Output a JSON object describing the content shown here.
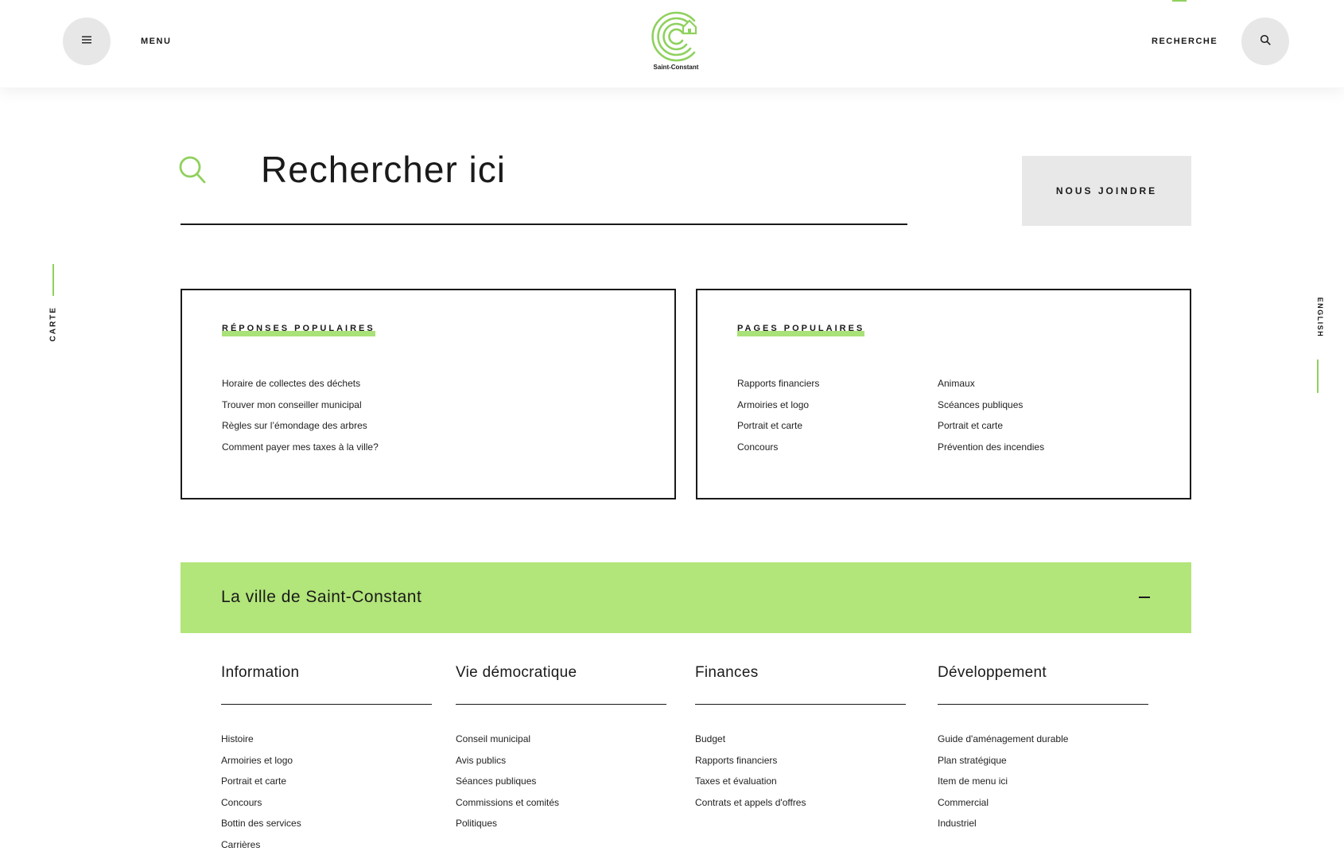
{
  "header": {
    "menu_label": "MENU",
    "search_label": "RECHERCHE",
    "logo_text": "Saint-Constant"
  },
  "side": {
    "left_label": "CARTE",
    "right_label": "ENGLISH"
  },
  "search": {
    "placeholder": "Rechercher ici",
    "contact_label": "NOUS JOINDRE"
  },
  "popular_answers": {
    "title": "RÉPONSES POPULAIRES",
    "items": [
      "Horaire de collectes des déchets",
      "Trouver mon conseiller municipal",
      "Règles sur l’émondage des arbres",
      "Comment payer mes taxes à la ville?"
    ]
  },
  "popular_pages": {
    "title": "PAGES POPULAIRES",
    "col1": [
      "Rapports financiers",
      "Armoiries et logo",
      "Portrait et carte",
      "Concours"
    ],
    "col2": [
      "Animaux",
      "Scéances publiques",
      "Portrait et carte",
      "Prévention des incendies"
    ]
  },
  "accordion": {
    "title": "La ville de Saint-Constant"
  },
  "columns": [
    {
      "title": "Information",
      "items": [
        "Histoire",
        "Armoiries et logo",
        "Portrait et carte",
        "Concours",
        "Bottin des services",
        "Carrières"
      ]
    },
    {
      "title": "Vie démocratique",
      "items": [
        "Conseil municipal",
        "Avis publics",
        "Séances publiques",
        "Commissions et comités",
        "Politiques"
      ]
    },
    {
      "title": "Finances",
      "items": [
        "Budget",
        "Rapports financiers",
        "Taxes et évaluation",
        "Contrats et appels d'offres"
      ]
    },
    {
      "title": "Développement",
      "items": [
        "Guide d'aménagement durable",
        "Plan stratégique",
        "Item de menu ici",
        "Commercial",
        "Industriel"
      ]
    }
  ],
  "colors": {
    "accent": "#8fd15e",
    "accordion_bg": "#b2e57a",
    "button_bg": "#e7e7e7"
  },
  "icons": {
    "menu": "hamburger-icon",
    "search": "search-icon",
    "collapse": "minus-icon"
  }
}
